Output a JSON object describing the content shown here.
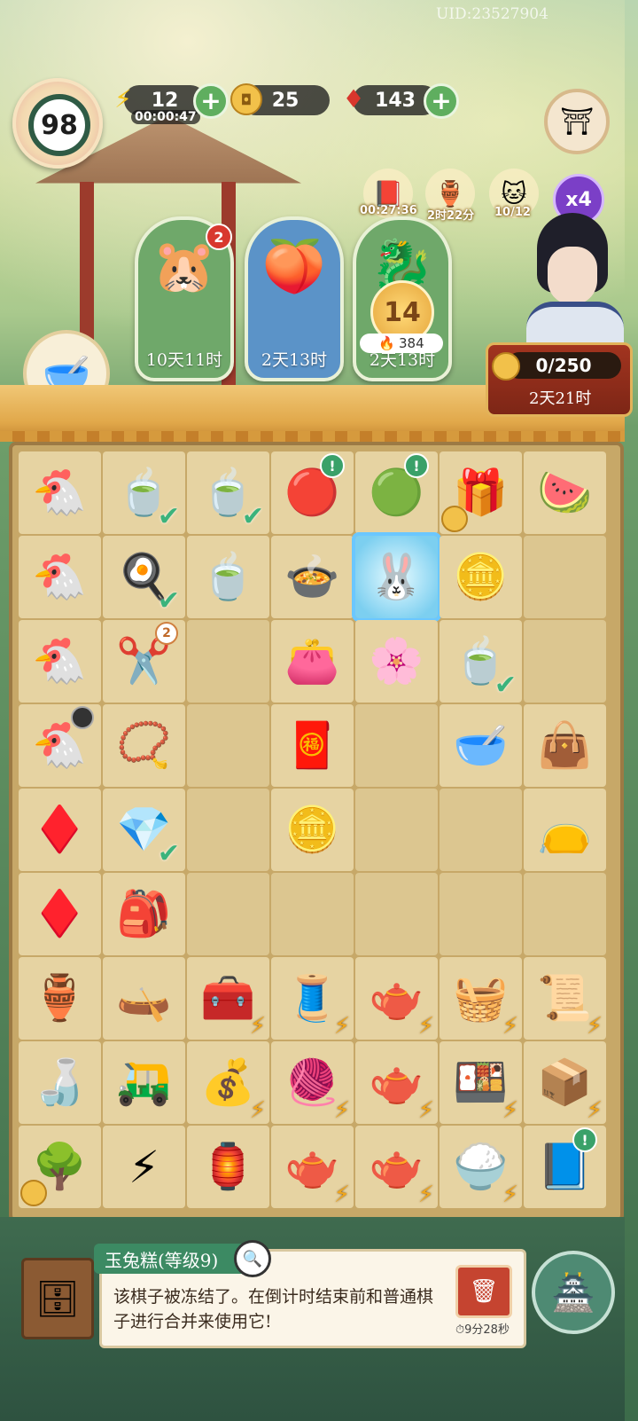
{
  "header": {
    "uid": "UID:23527904",
    "player_level": "98",
    "energy": {
      "value": "12",
      "timer": "00:00:47",
      "icon": "lightning-icon"
    },
    "coins": {
      "value": "25",
      "icon": "coin-icon"
    },
    "gems": {
      "value": "143",
      "icon": "ruby-icon"
    }
  },
  "events": [
    {
      "icon": "x2-book-icon",
      "label": "00:27:36"
    },
    {
      "icon": "golden-pot-icon",
      "label": "2时22分"
    },
    {
      "icon": "cat-icon",
      "label": "10/12"
    }
  ],
  "multiplier": "x4",
  "task_cards": [
    {
      "label": "10天11时",
      "icon": "cat-with-hat-icon",
      "badge": "2",
      "color": "#6fa86a"
    },
    {
      "label": "2天13时",
      "icon": "peach-icon",
      "color": "#5b93c8"
    },
    {
      "label": "2天13时",
      "icon": "dragon-icon",
      "level": "14",
      "fire": "384",
      "color": "#6fa86a"
    }
  ],
  "npc_progress": {
    "value": "0/250",
    "timer": "2天21时"
  },
  "board": {
    "rows": [
      [
        {
          "i": "🐔",
          "n": "hen-nest"
        },
        {
          "i": "🍵",
          "n": "tea-cup",
          "check": true
        },
        {
          "i": "🍵",
          "n": "tea-bowl",
          "check": true
        },
        {
          "i": "🔴",
          "n": "red-tin",
          "excl": true
        },
        {
          "i": "🟢",
          "n": "green-tin",
          "excl": true
        },
        {
          "i": "🎁",
          "n": "gift-bundle",
          "coin": true
        },
        {
          "i": "🍉",
          "n": "fruit-tray"
        }
      ],
      [
        {
          "i": "🐔",
          "n": "hen-well"
        },
        {
          "i": "🍳",
          "n": "fried-egg",
          "check": true
        },
        {
          "i": "🍵",
          "n": "tea-saucer"
        },
        {
          "i": "🍲",
          "n": "flower-soup"
        },
        {
          "i": "🐰",
          "n": "jade-rabbit-cake",
          "sel": true
        },
        {
          "i": "🪙",
          "n": "coins-pile"
        },
        {
          "i": "",
          "n": "empty"
        }
      ],
      [
        {
          "i": "🐔",
          "n": "hen"
        },
        {
          "i": "✂️",
          "n": "scissors",
          "num": "2"
        },
        {
          "i": "",
          "n": "empty"
        },
        {
          "i": "👛",
          "n": "purple-purse"
        },
        {
          "i": "🌸",
          "n": "flower-cake"
        },
        {
          "i": "🍵",
          "n": "tea-bowl-2",
          "check": true
        },
        {
          "i": "",
          "n": "empty"
        }
      ],
      [
        {
          "i": "🐔",
          "n": "hen-timer",
          "timer": true
        },
        {
          "i": "📿",
          "n": "bead-bracelet"
        },
        {
          "i": "",
          "n": "empty"
        },
        {
          "i": "🧧",
          "n": "red-scrolls"
        },
        {
          "i": "",
          "n": "empty"
        },
        {
          "i": "🥣",
          "n": "porridge-bowl"
        },
        {
          "i": "👜",
          "n": "purple-bag"
        }
      ],
      [
        {
          "i": "♦️",
          "n": "rubies"
        },
        {
          "i": "💎",
          "n": "earrings",
          "check": true
        },
        {
          "i": "",
          "n": "empty"
        },
        {
          "i": "🪙",
          "n": "coin"
        },
        {
          "i": "",
          "n": "empty"
        },
        {
          "i": "",
          "n": "empty"
        },
        {
          "i": "👝",
          "n": "purple-pouch"
        }
      ],
      [
        {
          "i": "♦️",
          "n": "ruby"
        },
        {
          "i": "🎒",
          "n": "drawstring-pouch"
        },
        {
          "i": "",
          "n": "empty"
        },
        {
          "i": "",
          "n": "empty"
        },
        {
          "i": "",
          "n": "empty"
        },
        {
          "i": "",
          "n": "empty"
        },
        {
          "i": "",
          "n": "empty"
        }
      ],
      [
        {
          "i": "🏺",
          "n": "wine-jar"
        },
        {
          "i": "🛶",
          "n": "boat"
        },
        {
          "i": "🧰",
          "n": "treasure-chest",
          "bolt": true
        },
        {
          "i": "🧵",
          "n": "loom",
          "bolt": true
        },
        {
          "i": "🫖",
          "n": "teapot-set",
          "bolt": true
        },
        {
          "i": "🧺",
          "n": "food-basket",
          "bolt": true
        },
        {
          "i": "📜",
          "n": "scroll-box",
          "bolt": true
        }
      ],
      [
        {
          "i": "🍶",
          "n": "gourd-bottle"
        },
        {
          "i": "🛺",
          "n": "cart"
        },
        {
          "i": "💰",
          "n": "jewel-chest",
          "bolt": true
        },
        {
          "i": "🧶",
          "n": "spinning-loom",
          "bolt": true
        },
        {
          "i": "🫖",
          "n": "teapot-fruit",
          "bolt": true
        },
        {
          "i": "🍱",
          "n": "food-box",
          "bolt": true
        },
        {
          "i": "📦",
          "n": "scroll-crate",
          "bolt": true
        }
      ],
      [
        {
          "i": "🌳",
          "n": "money-tree",
          "coin": true
        },
        {
          "i": "⚡",
          "n": "energy-vase"
        },
        {
          "i": "🏮",
          "n": "incense-burner"
        },
        {
          "i": "🫖",
          "n": "teapot",
          "bolt": true
        },
        {
          "i": "🫖",
          "n": "teapot-cups",
          "bolt": true
        },
        {
          "i": "🍚",
          "n": "rice-basket",
          "bolt": true
        },
        {
          "i": "📘",
          "n": "blue-book",
          "excl": true
        }
      ]
    ]
  },
  "selected_item": {
    "title": "玉兔糕(等级9)",
    "description": "该棋子被冻结了。在倒计时结束前和普通棋子进行合并来使用它!",
    "trash_timer": "9分28秒"
  }
}
